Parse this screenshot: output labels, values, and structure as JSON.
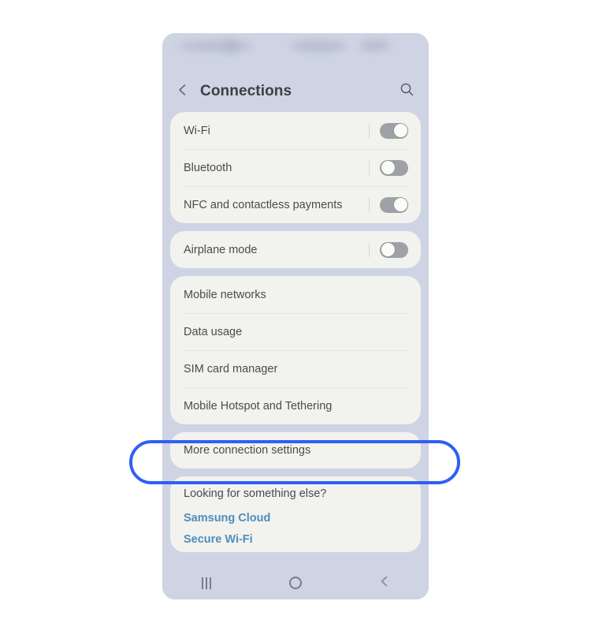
{
  "phone": {
    "statusbar": {
      "blurred": true
    },
    "header": {
      "back_icon": "chevron-left-icon",
      "title": "Connections",
      "search_icon": "search-icon"
    },
    "groups": [
      {
        "id": "toggles-primary",
        "rows": [
          {
            "label": "Wi-Fi",
            "toggle": "on"
          },
          {
            "label": "Bluetooth",
            "toggle": "off"
          },
          {
            "label": "NFC and contactless payments",
            "toggle": "on"
          }
        ]
      },
      {
        "id": "toggles-airplane",
        "rows": [
          {
            "label": "Airplane mode",
            "toggle": "off"
          }
        ]
      },
      {
        "id": "network-list",
        "rows": [
          {
            "label": "Mobile networks"
          },
          {
            "label": "Data usage"
          },
          {
            "label": "SIM card manager"
          },
          {
            "label": "Mobile Hotspot and Tethering"
          }
        ]
      },
      {
        "id": "more-settings",
        "highlighted": true,
        "rows": [
          {
            "label": "More connection settings"
          }
        ]
      }
    ],
    "suggestions": {
      "title": "Looking for something else?",
      "links": [
        {
          "label": "Samsung Cloud"
        },
        {
          "label": "Secure Wi-Fi"
        }
      ]
    },
    "navbar": {
      "recents_icon": "recents-icon",
      "home_icon": "home-circle-icon",
      "back_icon": "nav-back-icon"
    }
  },
  "colors": {
    "phone_background": "#CED4E3",
    "card_background": "#F2F2EE",
    "text_primary": "#494C51",
    "link": "#4F8DBD",
    "highlight_ring": "#2F5FF5",
    "toggle_track": "#9EA2A7",
    "toggle_knob": "#FBFBF8"
  }
}
